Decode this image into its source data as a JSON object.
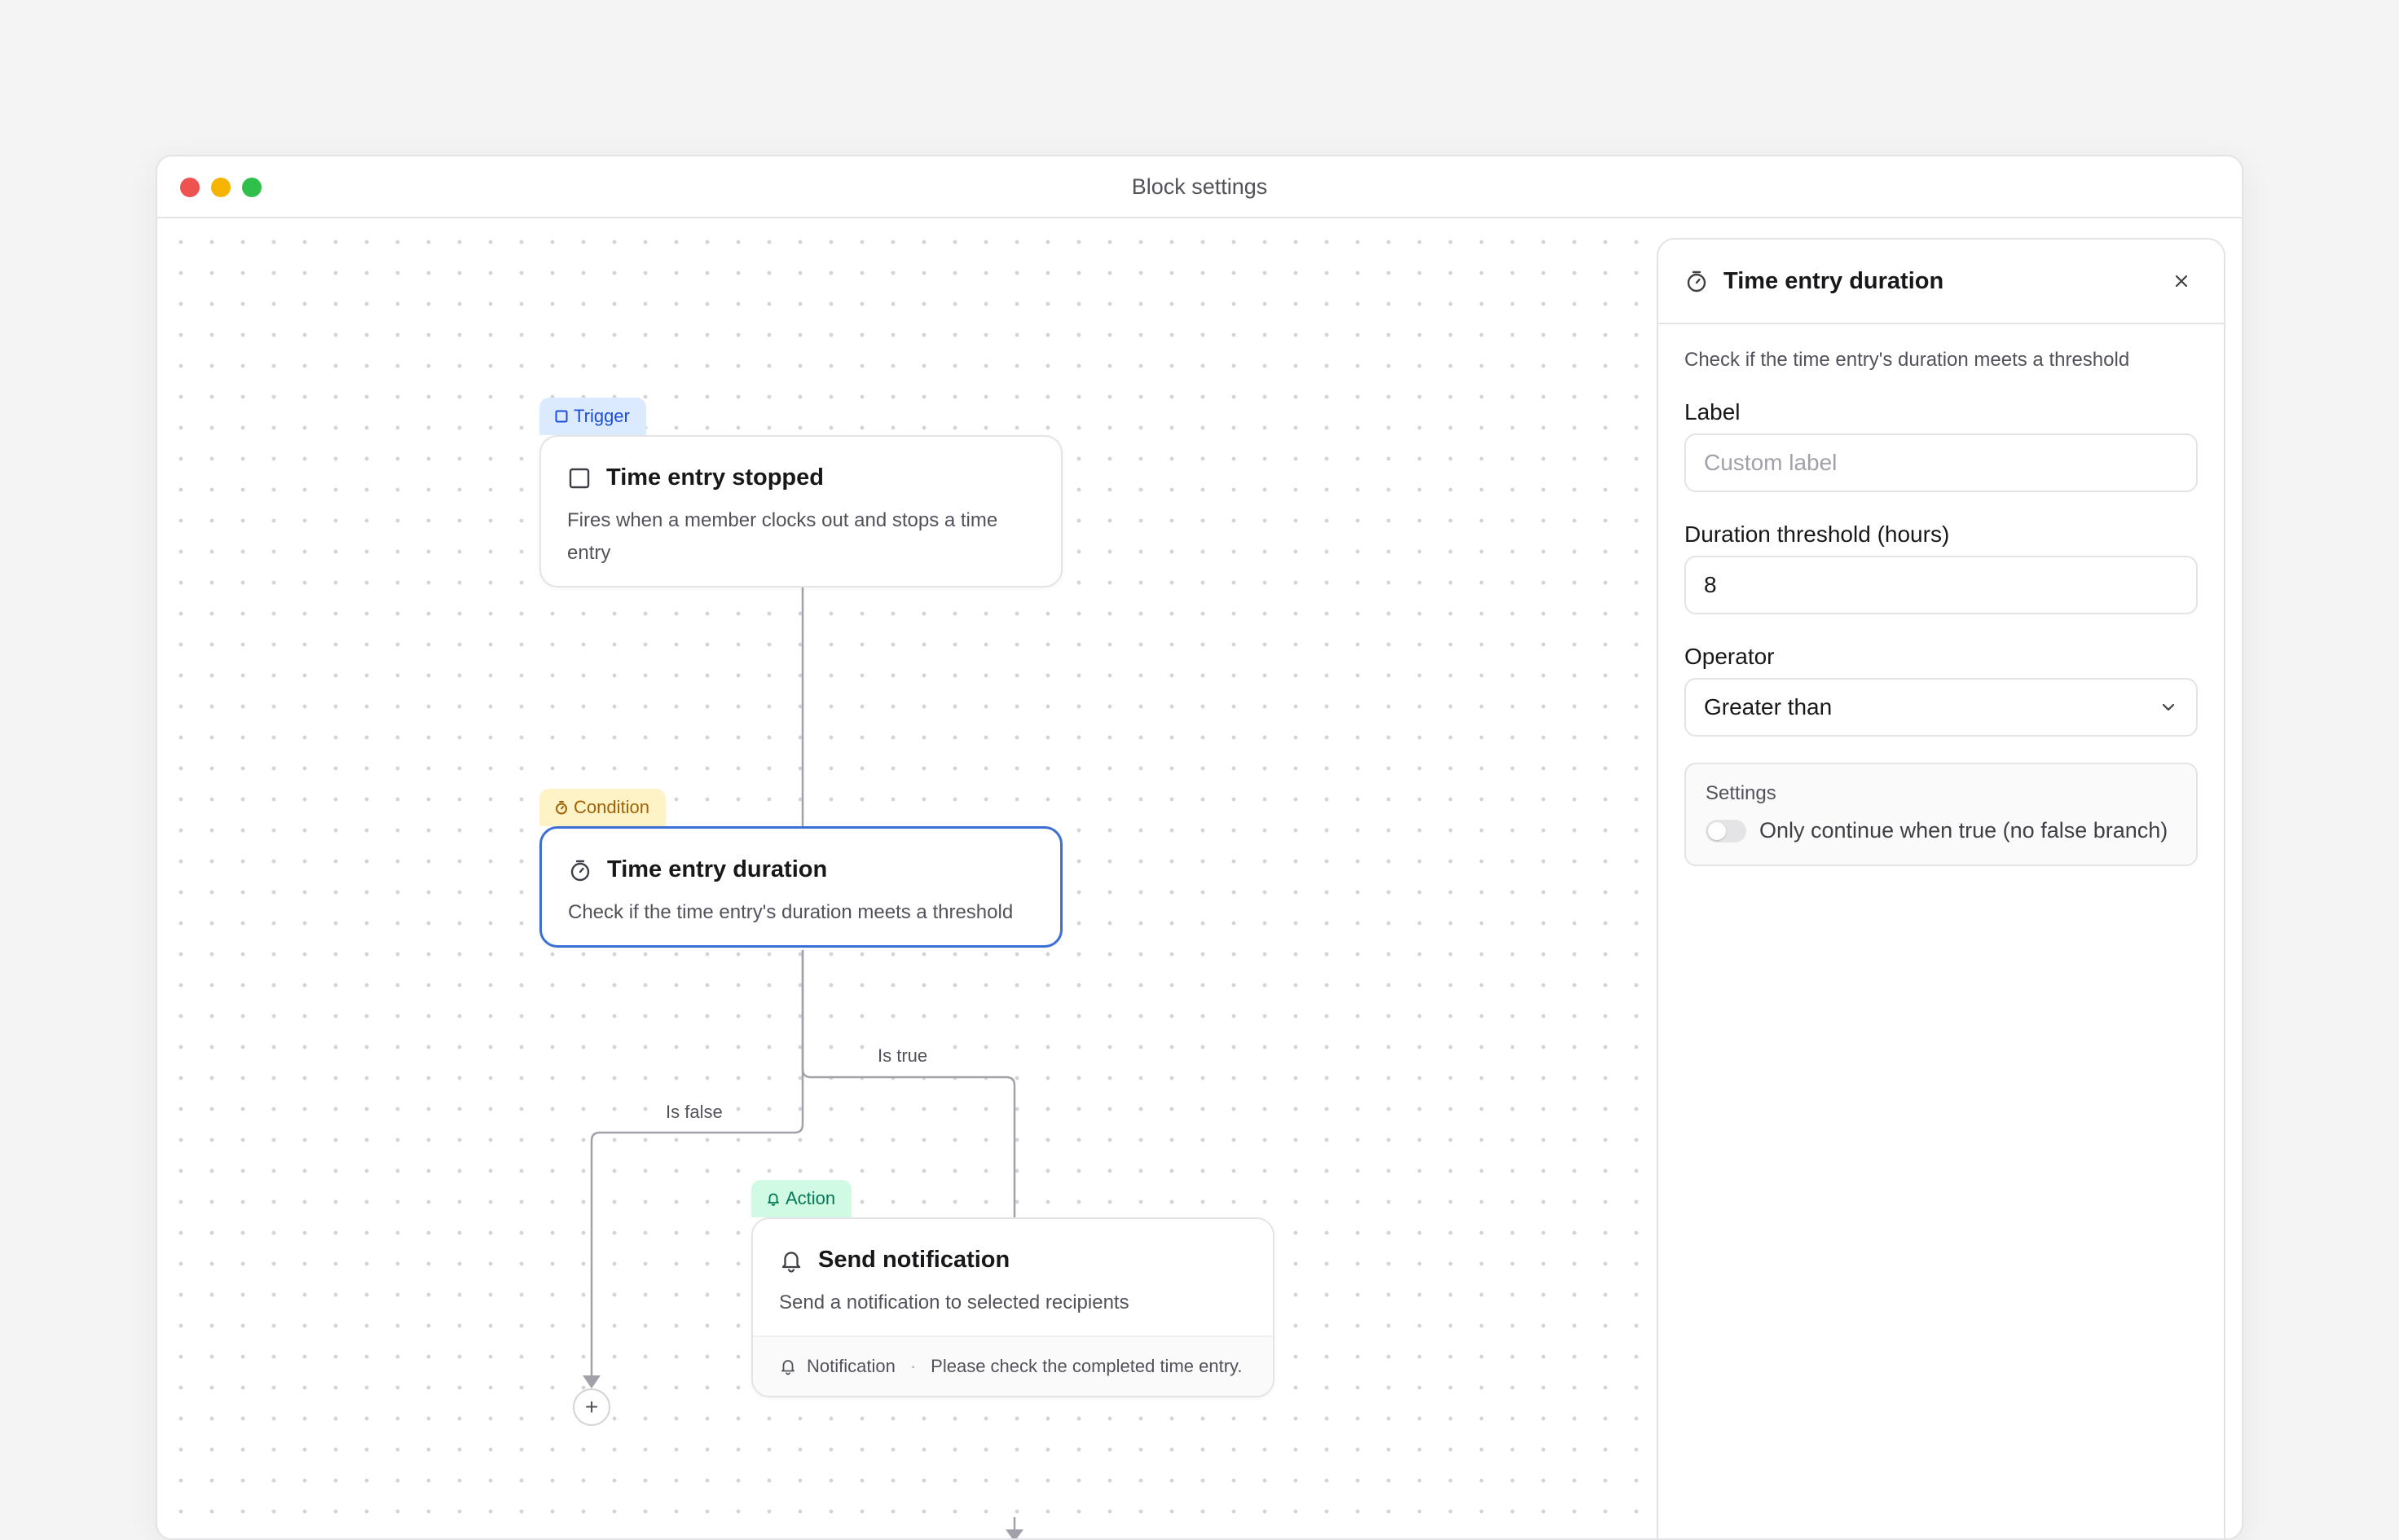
{
  "window": {
    "title": "Block settings"
  },
  "colors": {
    "accent": "#3b6fd6",
    "trigger": "#1d4ed8",
    "condition": "#a16207",
    "action": "#047857"
  },
  "nodes": {
    "trigger": {
      "tag": "Trigger",
      "icon": "square-icon",
      "title": "Time entry stopped",
      "description": "Fires when a member clocks out and stops a time entry"
    },
    "condition": {
      "tag": "Condition",
      "icon": "timer-icon",
      "title": "Time entry duration",
      "description": "Check if the time entry's duration meets a threshold"
    },
    "action": {
      "tag": "Action",
      "icon": "bell-icon",
      "title": "Send notification",
      "description": "Send a notification to selected recipients",
      "footer_label": "Notification",
      "footer_separator": "·",
      "footer_message": "Please check the completed time entry."
    }
  },
  "edges": {
    "true_label": "Is true",
    "false_label": "Is false"
  },
  "add_button": {
    "label": "+"
  },
  "panel": {
    "title": "Time entry duration",
    "description": "Check if the time entry's duration meets a threshold",
    "label_field": {
      "label": "Label",
      "placeholder": "Custom label",
      "value": ""
    },
    "threshold_field": {
      "label": "Duration threshold (hours)",
      "value": "8"
    },
    "operator_field": {
      "label": "Operator",
      "value": "Greater than"
    },
    "settings": {
      "title": "Settings",
      "toggle_label": "Only continue when true (no false branch)",
      "toggle_on": false
    }
  }
}
